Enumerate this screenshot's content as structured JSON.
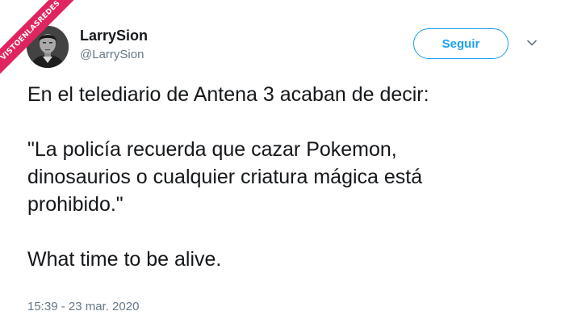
{
  "watermark": {
    "text": "VISTOENLASREDES",
    "color": "#e0245e"
  },
  "tweet": {
    "author": {
      "name": "LarrySion",
      "handle": "@LarrySion"
    },
    "follow_label": "Seguir",
    "lines": [
      "En el telediario de Antena 3 acaban de decir:",
      "\"La policía recuerda que cazar Pokemon,",
      "dinosaurios o cualquier criatura mágica está",
      "prohibido.\"",
      "What time to be alive."
    ],
    "timestamp": "15:39 - 23 mar. 2020"
  },
  "colors": {
    "accent": "#1da1f2",
    "text": "#14171a",
    "muted": "#657786"
  },
  "icons": {
    "menu": "chevron-down-icon",
    "avatar": "avatar"
  }
}
